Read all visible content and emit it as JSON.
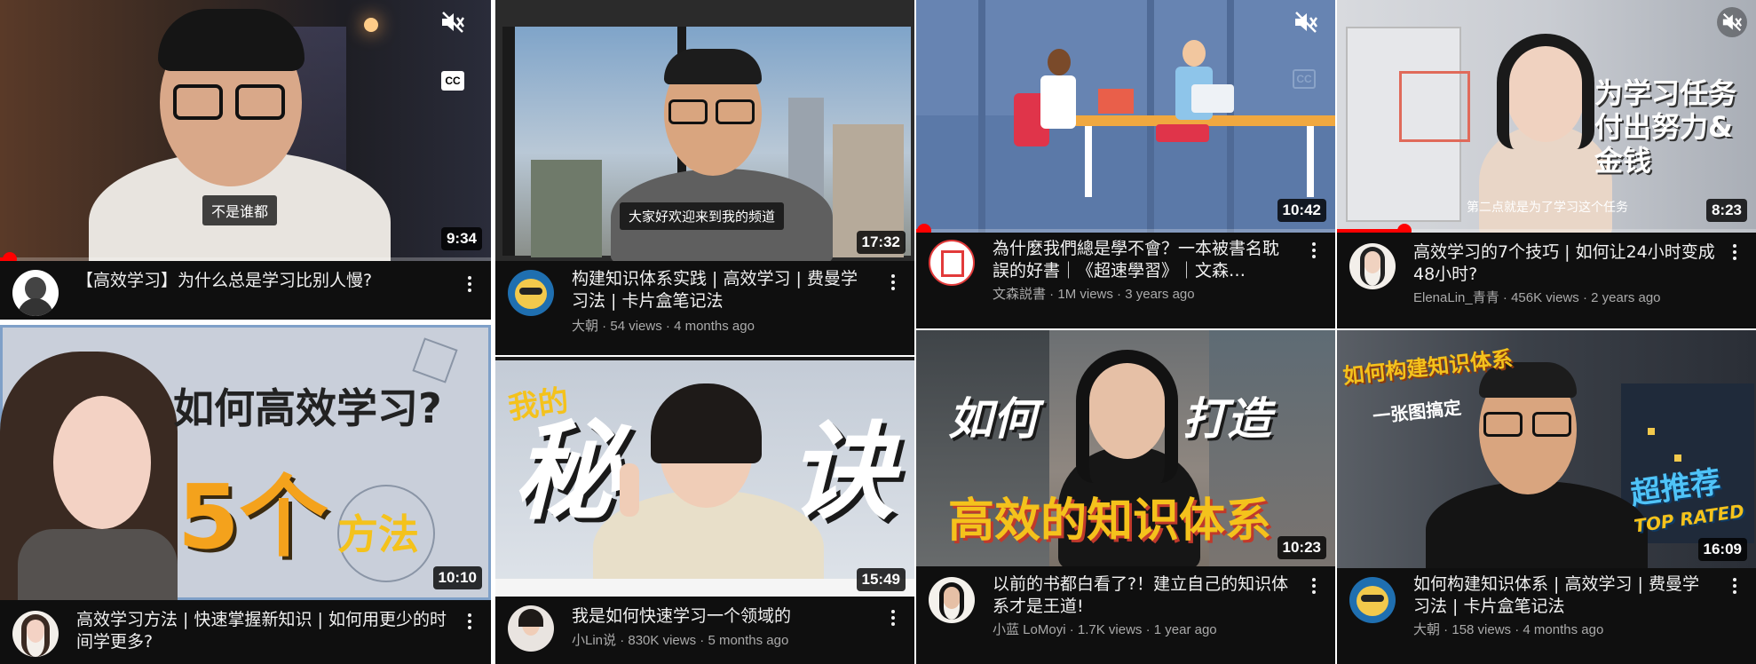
{
  "videos": [
    {
      "title": "【高效学习】为什么总是学习比别人慢?",
      "channel": "",
      "views": "",
      "age": "",
      "duration": "9:34",
      "caption": "不是谁都",
      "progress": 0.02,
      "muted": true,
      "cc": "CC"
    },
    {
      "title": "构建知识体系实践 | 高效学习 | 费曼学习法 | 卡片盒笔记法",
      "channel": "大朝",
      "views": "54 views",
      "age": "4 months ago",
      "duration": "17:32",
      "caption": "大家好欢迎来到我的频道"
    },
    {
      "title": "為什麼我們總是學不會？一本被書名耽誤的好書｜《超速學習》｜文森…",
      "channel": "文森説書",
      "views": "1M views",
      "age": "3 years ago",
      "duration": "10:42",
      "progress": 0.02,
      "muted": true,
      "cc": "CC"
    },
    {
      "title": "高效学习的7个技巧 | 如何让24小时变成48小时?",
      "channel": "ElenaLin_青青",
      "views": "456K views",
      "age": "2 years ago",
      "duration": "8:23",
      "caption": "第二点就是为了学习这个任务",
      "overlay_lines": [
        "为学习任务",
        "付出努力&",
        "金钱"
      ],
      "progress": 0.16,
      "muted": true
    },
    {
      "title": "高效学习方法 | 快速掌握新知识 | 如何用更少的时间学更多?",
      "channel": "",
      "views": "",
      "age": "",
      "duration": "10:10",
      "overlay_lines": [
        "如何高效学习?",
        "5个",
        "方法"
      ]
    },
    {
      "title": "我是如何快速学习一个领域的",
      "channel": "小Lin说",
      "views": "830K views",
      "age": "5 months ago",
      "duration": "15:49",
      "overlay_lines": [
        "我的",
        "秘",
        "诀"
      ]
    },
    {
      "title": "以前的书都白看了?！建立自己的知识体系才是王道!",
      "channel": "小蓝 LoMoyi",
      "views": "1.7K views",
      "age": "1 year ago",
      "duration": "10:23",
      "overlay_lines": [
        "如何",
        "打造",
        "高效的知识体系"
      ]
    },
    {
      "title": "如何构建知识体系 | 高效学习 | 费曼学习法 | 卡片盒笔记法",
      "channel": "大朝",
      "views": "158 views",
      "age": "4 months ago",
      "duration": "16:09",
      "overlay_lines": [
        "如何构建知识体系",
        "一张图搞定",
        "超推荐",
        "TOP RATED"
      ]
    }
  ],
  "separator": " · ",
  "colors": {
    "background": "#0f0f0f",
    "title": "#f1f1f1",
    "meta": "#aaaaaa",
    "progress": "#ff0000"
  }
}
